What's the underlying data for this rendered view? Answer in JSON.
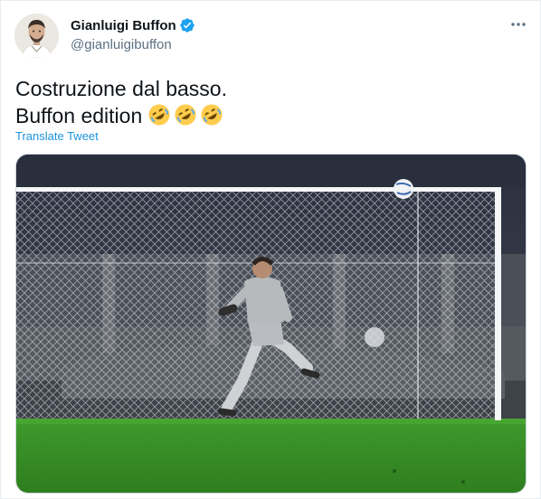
{
  "author": {
    "display_name": "Gianluigi Buffon",
    "handle": "@gianluigibuffon",
    "verified": true,
    "avatar_icon": "profile-photo"
  },
  "tweet": {
    "text_line1": "Costruzione dal basso.",
    "text_line2": "Buffon edition",
    "emojis": [
      "rolling-on-the-floor-laughing",
      "rolling-on-the-floor-laughing",
      "rolling-on-the-floor-laughing"
    ],
    "translate_label": "Translate Tweet"
  },
  "media": {
    "description_icon": "goalkeeper-kicking-ball-photo"
  },
  "colors": {
    "link": "#1b95e0",
    "verified_badge": "#1da1f2",
    "secondary_text": "#5b7083",
    "primary_text": "#0f1419"
  }
}
